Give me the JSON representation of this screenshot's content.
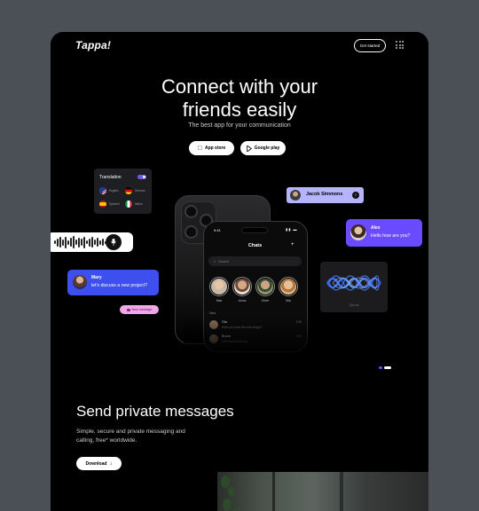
{
  "header": {
    "logo": "Tappa!",
    "get_started": "Get started",
    "menu_icon": "grid-dots-icon"
  },
  "hero": {
    "title_line1": "Connect with your",
    "title_line2": "friends easily",
    "subtitle": "The best app for your communication",
    "app_store": "App store",
    "google_play": "Google play"
  },
  "translation": {
    "title": "Translation",
    "toggle_on": true,
    "languages": [
      "English",
      "German",
      "Spanish",
      "Italian"
    ]
  },
  "mary": {
    "name": "Mary",
    "message": "let's discuss a new project?"
  },
  "new_message": "New message",
  "jacob": {
    "name": "Jacob Simmons"
  },
  "alex": {
    "name": "Alex",
    "message": "Hello how are you?"
  },
  "speak": {
    "label": "Speak"
  },
  "phone": {
    "time": "9:41",
    "title": "Chats",
    "search_placeholder": "Search",
    "stories": [
      "Max",
      "Amos",
      "Oliver",
      "Mia"
    ],
    "new_label": "New",
    "chats": [
      {
        "name": "Ola",
        "message": "Have you seen the new design?",
        "time": "9:40"
      },
      {
        "name": "Bruno",
        "message": "Let's meet tomorrow",
        "time": "9:12"
      }
    ]
  },
  "section": {
    "title": "Send private messages",
    "subtitle": "Simple, secure and private messaging and calling, free* worldwide.",
    "download": "Download"
  },
  "colors": {
    "accent_blue": "#3d4fef",
    "accent_purple": "#6b4bff",
    "lavender": "#b6b4ff",
    "pink": "#f0a6e8"
  }
}
